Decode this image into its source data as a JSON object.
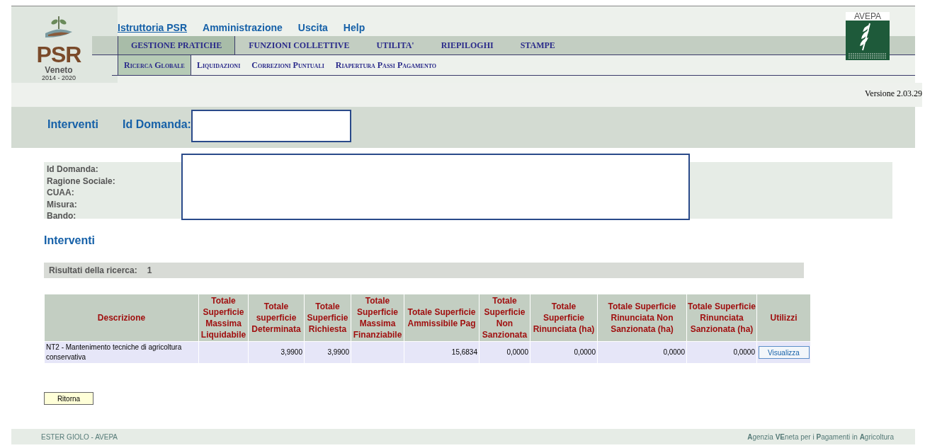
{
  "logo": {
    "title": "PSR",
    "region": "Veneto",
    "period": "2014 - 2020"
  },
  "agency_logo": {
    "title": "AVEPA"
  },
  "top_menu": [
    {
      "label": "Istruttoria PSR",
      "selected": true
    },
    {
      "label": "Amministrazione",
      "selected": false
    },
    {
      "label": "Uscita",
      "selected": false
    },
    {
      "label": "Help",
      "selected": false
    }
  ],
  "main_menu": [
    {
      "label": "GESTIONE PRATICHE",
      "selected": true
    },
    {
      "label": "FUNZIONI COLLETTIVE",
      "selected": false
    },
    {
      "label": "UTILITA'",
      "selected": false
    },
    {
      "label": "RIEPILOGHI",
      "selected": false
    },
    {
      "label": "STAMPE",
      "selected": false
    }
  ],
  "sub_menu": [
    {
      "label": "Ricerca Globale",
      "selected": true
    },
    {
      "label": "Liquidazioni",
      "selected": false
    },
    {
      "label": "Correzioni Puntuali",
      "selected": false
    },
    {
      "label": "Riapertura Passi Pagamento",
      "selected": false
    }
  ],
  "version": "Versione 2.03.29",
  "page_header": {
    "title": "Interventi",
    "id_label": "Id Domanda:"
  },
  "details": [
    "Id Domanda:",
    "Ragione Sociale:",
    "CUAA:",
    "Misura:",
    "Bando:"
  ],
  "section_title": "Interventi",
  "results": {
    "label": "Risultati della ricerca:",
    "count": "1"
  },
  "table": {
    "columns": [
      "Descrizione",
      "Totale Superficie Massima Liquidabile",
      "Totale superficie Determinata",
      "Totale Superficie Richiesta",
      "Totale Superficie Massima Finanziabile",
      "Totale Superficie Ammissibile Pag",
      "Totale Superficie Non Sanzionata",
      "Totale Superficie Rinunciata (ha)",
      "Totale Superficie Rinunciata Non Sanzionata (ha)",
      "Totale Superficie Rinunciata Sanzionata (ha)",
      "Utilizzi"
    ],
    "rows": [
      {
        "cells": [
          "NT2 - Mantenimento tecniche di agricoltura conservativa",
          "",
          "3,9900",
          "3,9900",
          "",
          "15,6834",
          "0,0000",
          "0,0000",
          "0,0000",
          "0,0000"
        ],
        "action": "Visualizza"
      }
    ]
  },
  "back_button": "Ritorna",
  "footer": {
    "left": "ESTER GIOLO - AVEPA",
    "right": "**A**genzia **VE**neta per i **P**agamenti in **A**gricoltura"
  }
}
